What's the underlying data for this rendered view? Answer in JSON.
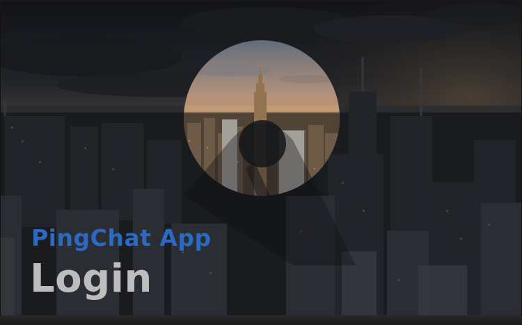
{
  "hero": {
    "app_name": "PingChat App",
    "heading": "Login"
  },
  "icons": {
    "hero_mark": "circle-with-diagonal-tail-icon"
  },
  "colors": {
    "app_name": "#2a6ac2",
    "heading": "#bdbdbd",
    "overlay": "#0d0f14",
    "sunset": "#e8a46a"
  }
}
